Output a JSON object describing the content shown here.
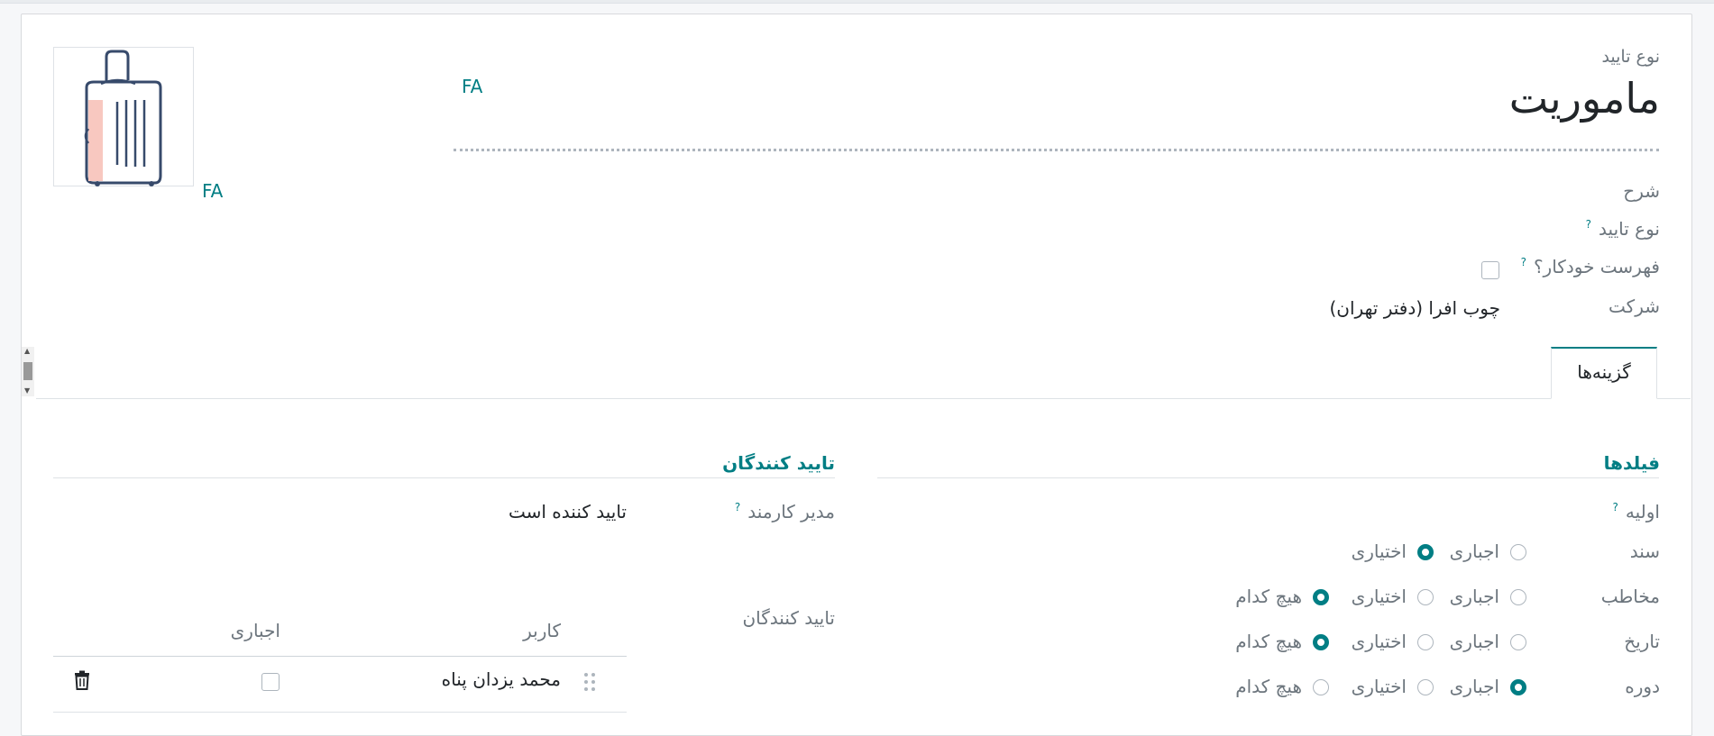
{
  "record": {
    "type_label": "نوع تایید",
    "name": "ماموریت",
    "lang_tag": "FA",
    "image_lang_tag": "FA"
  },
  "fields": {
    "description_label": "شرح",
    "approval_type_label": "نوع تایید",
    "auto_sequence_label": "فهرست خودکار؟",
    "company_label": "شرکت",
    "company_value": "چوب افرا (دفتر تهران)",
    "help_mark": "?"
  },
  "tabs": [
    {
      "label": "گزینه‌ها",
      "active": true
    }
  ],
  "options": {
    "fields_section_title": "فیلدها",
    "initial_label": "اولیه",
    "rows": [
      {
        "label": "سند",
        "choices": [
          "اجباری",
          "اختیاری"
        ],
        "selected": "اختیاری"
      },
      {
        "label": "مخاطب",
        "choices": [
          "اجباری",
          "اختیاری",
          "هیچ کدام"
        ],
        "selected": "هیچ کدام"
      },
      {
        "label": "تاریخ",
        "choices": [
          "اجباری",
          "اختیاری",
          "هیچ کدام"
        ],
        "selected": "هیچ کدام"
      },
      {
        "label": "دوره",
        "choices": [
          "اجباری",
          "اختیاری",
          "هیچ کدام"
        ],
        "selected": "اجباری"
      }
    ],
    "approvers_section_title": "تایید کنندگان",
    "employee_manager_label": "مدیر کارمند",
    "employee_manager_value": "تایید کننده است",
    "approvers_label": "تایید کنندگان",
    "approvers_table": {
      "columns": [
        "کاربر",
        "اجباری"
      ],
      "rows": [
        {
          "user": "محمد یزدان پناه",
          "required": false
        }
      ]
    }
  },
  "colors": {
    "accent": "#017e84",
    "muted_text": "#6c757d",
    "border": "#dee2e6"
  },
  "icons": {
    "image": "suitcase-icon",
    "delete": "trash-icon",
    "drag": "drag-handle-icon"
  }
}
